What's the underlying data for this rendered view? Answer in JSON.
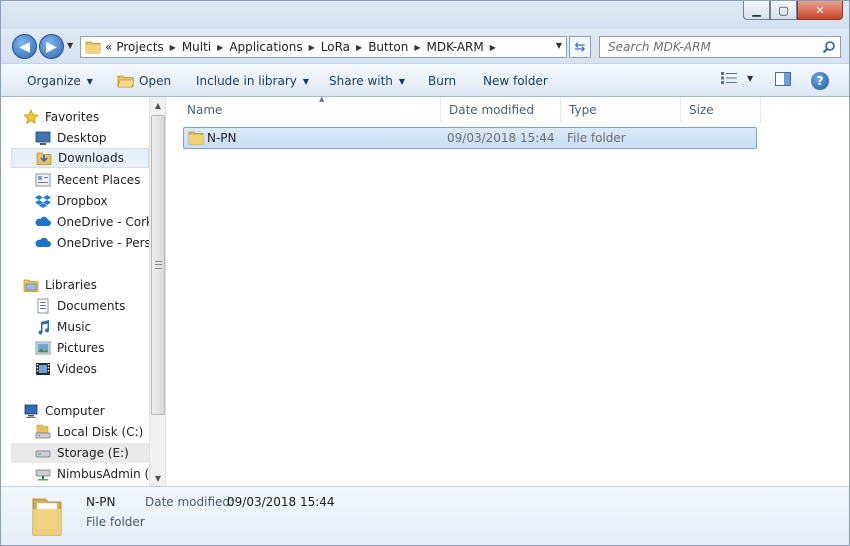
{
  "window": {
    "minimize_icon": "minimize-icon",
    "maximize_icon": "maximize-icon",
    "close_icon": "close-icon"
  },
  "address_bar": {
    "prefix": "«",
    "crumbs": [
      "Projects",
      "Multi",
      "Applications",
      "LoRa",
      "Button",
      "MDK-ARM"
    ],
    "search_placeholder": "Search MDK-ARM"
  },
  "toolbar": {
    "organize": "Organize",
    "open": "Open",
    "include_in_library": "Include in library",
    "share_with": "Share with",
    "burn": "Burn",
    "new_folder": "New folder"
  },
  "nav": {
    "favorites": "Favorites",
    "desktop": "Desktop",
    "downloads": "Downloads",
    "recent_places": "Recent Places",
    "dropbox": "Dropbox",
    "onedrive_cork": "OneDrive - Cork I",
    "onedrive_personal": "OneDrive - Perso",
    "libraries": "Libraries",
    "documents": "Documents",
    "music": "Music",
    "pictures": "Pictures",
    "videos": "Videos",
    "computer": "Computer",
    "local_disk": "Local Disk (C:)",
    "storage": "Storage (E:)",
    "nimbus": "NimbusAdmin (\\"
  },
  "columns": {
    "name": "Name",
    "date_modified": "Date modified",
    "type": "Type",
    "size": "Size"
  },
  "files": [
    {
      "name": "N-PN",
      "date_modified": "09/03/2018 15:44",
      "type": "File folder",
      "size": ""
    }
  ],
  "details": {
    "name": "N-PN",
    "type": "File folder",
    "date_modified_label": "Date modified:",
    "date_modified_value": "09/03/2018 15:44"
  }
}
